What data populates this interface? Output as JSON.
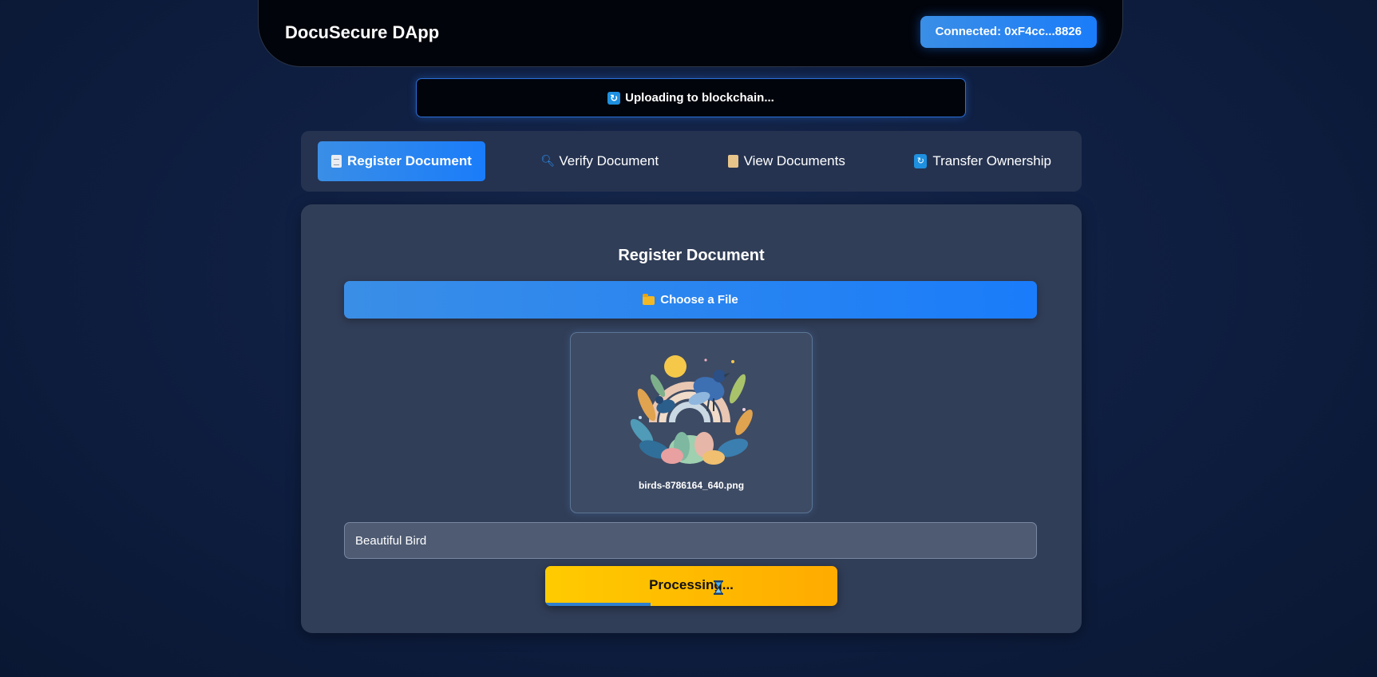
{
  "header": {
    "app_title": "DocuSecure DApp",
    "wallet_label": "Connected: 0xF4cc...8826"
  },
  "status": {
    "icon": "refresh-icon",
    "icon_glyph": "🔄",
    "text": "Uploading to blockchain..."
  },
  "tabs": [
    {
      "label": "Register Document",
      "icon": "page-icon",
      "active": true
    },
    {
      "label": "Verify Document",
      "icon": "magnifier-icon",
      "active": false
    },
    {
      "label": "View Documents",
      "icon": "scroll-icon",
      "active": false
    },
    {
      "label": "Transfer Ownership",
      "icon": "refresh-icon",
      "active": false
    }
  ],
  "form": {
    "title": "Register Document",
    "choose_file_label": "Choose a File",
    "preview": {
      "file_name": "birds-8786164_640.png"
    },
    "description_value": "Beautiful Bird",
    "submit_label": "Processing...",
    "progress_fraction": 0.36
  },
  "colors": {
    "accent": "#1a7cfa",
    "processing": "#ffb800",
    "background": "#0f1f42"
  }
}
